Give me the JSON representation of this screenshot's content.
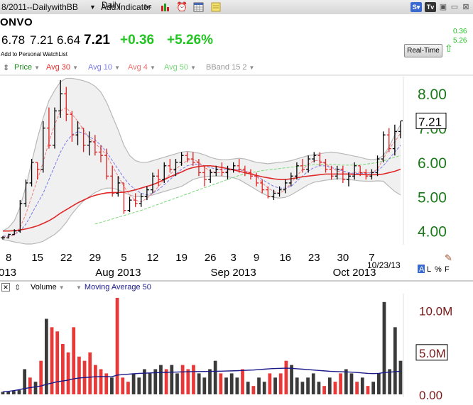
{
  "window": {
    "title": "8/2011--DailywithBB",
    "add_indicator": "Add Indicator",
    "interval": "Daily"
  },
  "toolbar_icons": [
    "wrench-icon",
    "bar-chart-icon",
    "alarm-clock-icon",
    "calendar-icon",
    "note-icon"
  ],
  "titlebar_buttons": [
    "s-button",
    "tv-button",
    "save-icon",
    "window-icon",
    "close-icon"
  ],
  "quote": {
    "symbol": "ONVO",
    "open": "6.78",
    "high": "7.21",
    "low": "6.64",
    "last": "7.21",
    "change": "+0.36",
    "change_pct": "+5.26%",
    "watchlist": "Add to Personal WatchList",
    "realtime_label": "Real-Time",
    "realtime_change": "0.36",
    "realtime_pct": "5.26"
  },
  "price_legend": [
    {
      "label": "Price",
      "color": "#1a8a1a"
    },
    {
      "label": "Avg 30",
      "color": "#e83030"
    },
    {
      "label": "Avg 10",
      "color": "#7a7ae6"
    },
    {
      "label": "Avg 4",
      "color": "#f07070"
    },
    {
      "label": "Avg 50",
      "color": "#77d877"
    },
    {
      "label": "BBand 15 2",
      "color": "#999999"
    }
  ],
  "volume_legend": [
    {
      "label": "Volume",
      "color": "#000000"
    },
    {
      "label": "Moving Average 50",
      "color": "#1a1a8a"
    }
  ],
  "date_label": "10/23/13",
  "scale_buttons": [
    "A",
    "L",
    "%",
    "F"
  ],
  "chart_data": {
    "type": "bar",
    "price_axis": {
      "min": 3.6,
      "max": 8.5,
      "ticks": [
        "8.00",
        "7.00",
        "6.00",
        "5.00",
        "4.00"
      ],
      "tick_values": [
        8,
        7,
        6,
        5,
        4
      ],
      "last_label": "7.21"
    },
    "volume_axis": {
      "min": 0,
      "max": 12,
      "ticks": [
        "10.0M",
        "5.0M",
        "0.00"
      ],
      "tick_values": [
        10,
        5,
        0
      ]
    },
    "x_ticks": [
      {
        "label": "8",
        "i": 1
      },
      {
        "label": "15",
        "i": 6
      },
      {
        "label": "22",
        "i": 11
      },
      {
        "label": "29",
        "i": 16
      },
      {
        "label": "5",
        "i": 21
      },
      {
        "label": "12",
        "i": 26
      },
      {
        "label": "19",
        "i": 31
      },
      {
        "label": "26",
        "i": 36
      },
      {
        "label": "3",
        "i": 40
      },
      {
        "label": "9",
        "i": 44
      },
      {
        "label": "16",
        "i": 49
      },
      {
        "label": "23",
        "i": 54
      },
      {
        "label": "30",
        "i": 59
      },
      {
        "label": "7",
        "i": 64
      }
    ],
    "x_month_labels": [
      {
        "label": "013",
        "i": 0
      },
      {
        "label": "Aug 2013",
        "i": 20
      },
      {
        "label": "Sep 2013",
        "i": 40
      },
      {
        "label": "Oct 2013",
        "i": 61
      }
    ],
    "ohlc": [
      [
        3.8,
        3.85,
        3.75,
        3.8
      ],
      [
        3.8,
        3.92,
        3.78,
        3.9
      ],
      [
        3.9,
        4.05,
        3.88,
        4.0
      ],
      [
        4.0,
        4.9,
        3.95,
        4.8
      ],
      [
        4.8,
        5.5,
        4.7,
        5.4
      ],
      [
        5.4,
        6.1,
        5.3,
        6.0
      ],
      [
        6.0,
        6.0,
        5.5,
        5.8
      ],
      [
        5.8,
        7.2,
        5.7,
        7.0
      ],
      [
        7.0,
        7.6,
        6.4,
        6.5
      ],
      [
        6.5,
        7.6,
        6.4,
        7.5
      ],
      [
        7.5,
        8.4,
        7.3,
        8.0
      ],
      [
        8.0,
        8.2,
        7.2,
        7.4
      ],
      [
        7.4,
        7.5,
        6.6,
        6.8
      ],
      [
        6.8,
        7.2,
        6.5,
        7.0
      ],
      [
        7.0,
        7.0,
        6.3,
        6.5
      ],
      [
        6.5,
        6.9,
        6.2,
        6.6
      ],
      [
        6.6,
        6.8,
        6.2,
        6.3
      ],
      [
        6.3,
        6.5,
        6.0,
        6.2
      ],
      [
        6.2,
        6.4,
        5.5,
        5.6
      ],
      [
        5.6,
        5.9,
        5.0,
        5.1
      ],
      [
        5.1,
        5.6,
        5.0,
        5.4
      ],
      [
        5.4,
        5.4,
        4.5,
        4.6
      ],
      [
        4.6,
        5.0,
        4.55,
        4.9
      ],
      [
        4.9,
        5.1,
        4.7,
        4.8
      ],
      [
        4.8,
        5.1,
        4.7,
        5.0
      ],
      [
        5.0,
        5.3,
        4.9,
        5.2
      ],
      [
        5.2,
        5.7,
        5.1,
        5.6
      ],
      [
        5.6,
        5.8,
        5.3,
        5.5
      ],
      [
        5.5,
        6.0,
        5.4,
        5.9
      ],
      [
        5.9,
        6.1,
        5.7,
        5.8
      ],
      [
        5.8,
        6.1,
        5.6,
        6.0
      ],
      [
        6.0,
        6.3,
        5.9,
        6.2
      ],
      [
        6.2,
        6.3,
        6.0,
        6.1
      ],
      [
        6.1,
        6.3,
        5.9,
        6.0
      ],
      [
        6.0,
        6.1,
        5.6,
        5.7
      ],
      [
        5.7,
        5.9,
        5.3,
        5.5
      ],
      [
        5.5,
        5.8,
        5.4,
        5.7
      ],
      [
        5.7,
        5.9,
        5.6,
        5.8
      ],
      [
        5.8,
        6.0,
        5.6,
        5.7
      ],
      [
        5.7,
        5.9,
        5.5,
        5.8
      ],
      [
        5.8,
        6.0,
        5.7,
        5.9
      ],
      [
        5.9,
        6.1,
        5.7,
        5.8
      ],
      [
        5.8,
        5.9,
        5.6,
        5.7
      ],
      [
        5.7,
        5.8,
        5.5,
        5.6
      ],
      [
        5.6,
        5.7,
        5.3,
        5.4
      ],
      [
        5.4,
        5.5,
        5.1,
        5.2
      ],
      [
        5.2,
        5.3,
        4.95,
        5.0
      ],
      [
        5.0,
        5.2,
        4.9,
        5.1
      ],
      [
        5.1,
        5.3,
        5.0,
        5.2
      ],
      [
        5.2,
        5.5,
        5.1,
        5.4
      ],
      [
        5.4,
        5.7,
        5.3,
        5.6
      ],
      [
        5.6,
        6.0,
        5.5,
        5.9
      ],
      [
        5.9,
        6.1,
        5.7,
        5.8
      ],
      [
        5.8,
        6.2,
        5.7,
        6.1
      ],
      [
        6.1,
        6.3,
        6.0,
        6.2
      ],
      [
        6.2,
        6.3,
        5.9,
        6.0
      ],
      [
        6.0,
        6.1,
        5.7,
        5.8
      ],
      [
        5.8,
        5.9,
        5.5,
        5.6
      ],
      [
        5.6,
        5.9,
        5.5,
        5.8
      ],
      [
        5.8,
        5.9,
        5.4,
        5.5
      ],
      [
        5.5,
        5.7,
        5.3,
        5.6
      ],
      [
        5.6,
        6.0,
        5.5,
        5.9
      ],
      [
        5.9,
        5.9,
        5.6,
        5.7
      ],
      [
        5.7,
        5.8,
        5.5,
        5.6
      ],
      [
        5.6,
        5.8,
        5.5,
        5.7
      ],
      [
        5.7,
        6.2,
        5.6,
        6.1
      ],
      [
        6.1,
        6.9,
        6.0,
        6.8
      ],
      [
        6.8,
        7.0,
        6.3,
        6.4
      ],
      [
        6.4,
        7.1,
        6.2,
        6.9
      ],
      [
        6.9,
        7.2,
        6.7,
        7.21
      ]
    ],
    "bband_upper": [
      4.0,
      4.1,
      4.3,
      4.7,
      5.3,
      6.0,
      6.7,
      7.3,
      7.8,
      8.1,
      8.35,
      8.45,
      8.45,
      8.42,
      8.38,
      8.32,
      8.22,
      8.05,
      7.75,
      7.35,
      6.95,
      6.5,
      6.2,
      6.05,
      6.0,
      6.0,
      6.05,
      6.1,
      6.15,
      6.2,
      6.25,
      6.3,
      6.32,
      6.3,
      6.27,
      6.22,
      6.15,
      6.1,
      6.08,
      6.08,
      6.1,
      6.12,
      6.1,
      6.05,
      6.0,
      5.98,
      5.96,
      5.98,
      6.0,
      6.02,
      6.05,
      6.1,
      6.15,
      6.2,
      6.22,
      6.25,
      6.28,
      6.3,
      6.28,
      6.25,
      6.22,
      6.18,
      6.15,
      6.1,
      6.08,
      6.1,
      6.2,
      6.45,
      6.8,
      7.1
    ],
    "bband_lower": [
      3.75,
      3.72,
      3.68,
      3.65,
      3.62,
      3.62,
      3.65,
      3.7,
      3.8,
      3.9,
      4.05,
      4.25,
      4.5,
      4.7,
      4.88,
      5.0,
      5.12,
      5.2,
      5.25,
      5.25,
      5.2,
      5.12,
      5.05,
      5.0,
      5.0,
      5.02,
      5.05,
      5.1,
      5.15,
      5.2,
      5.25,
      5.3,
      5.4,
      5.5,
      5.55,
      5.58,
      5.6,
      5.6,
      5.6,
      5.58,
      5.55,
      5.5,
      5.4,
      5.3,
      5.2,
      5.1,
      5.02,
      4.98,
      4.96,
      4.98,
      5.05,
      5.15,
      5.25,
      5.35,
      5.42,
      5.45,
      5.48,
      5.5,
      5.52,
      5.52,
      5.5,
      5.48,
      5.46,
      5.45,
      5.45,
      5.46,
      5.45,
      5.3,
      5.15,
      5.05
    ],
    "avg30": [
      4.0,
      4.0,
      4.01,
      4.03,
      4.06,
      4.1,
      4.15,
      4.22,
      4.3,
      4.4,
      4.52,
      4.62,
      4.72,
      4.82,
      4.9,
      4.98,
      5.04,
      5.08,
      5.11,
      5.12,
      5.12,
      5.13,
      5.16,
      5.2,
      5.25,
      5.3,
      5.35,
      5.42,
      5.5,
      5.58,
      5.65,
      5.72,
      5.8,
      5.85,
      5.88,
      5.9,
      5.9,
      5.88,
      5.85,
      5.82,
      5.78,
      5.74,
      5.7,
      5.66,
      5.62,
      5.58,
      5.55,
      5.52,
      5.5,
      5.5,
      5.52,
      5.55,
      5.58,
      5.6,
      5.62,
      5.64,
      5.66,
      5.66,
      5.66,
      5.66,
      5.66,
      5.65,
      5.65,
      5.64,
      5.64,
      5.64,
      5.66,
      5.7,
      5.74,
      5.8
    ],
    "avg50": [
      null,
      null,
      null,
      null,
      null,
      null,
      null,
      null,
      null,
      null,
      null,
      null,
      null,
      null,
      null,
      null,
      4.2,
      4.25,
      4.3,
      4.35,
      4.4,
      4.45,
      4.5,
      4.55,
      4.6,
      4.66,
      4.72,
      4.78,
      4.84,
      4.9,
      4.96,
      5.02,
      5.08,
      5.14,
      5.2,
      5.26,
      5.32,
      5.38,
      5.44,
      5.5,
      5.56,
      5.62,
      5.66,
      5.7,
      5.73,
      5.76,
      5.78,
      5.8,
      5.82,
      5.84,
      5.86,
      5.88,
      5.9,
      5.92,
      5.93,
      5.94,
      5.94,
      5.94,
      5.93,
      5.92,
      5.92,
      5.92,
      5.93,
      5.95,
      5.97,
      6.0,
      6.04,
      6.1,
      6.15,
      6.2
    ],
    "avg10": [
      3.85,
      3.85,
      3.9,
      4.0,
      4.2,
      4.5,
      4.8,
      5.1,
      5.5,
      5.9,
      6.3,
      6.6,
      6.8,
      6.9,
      6.85,
      6.75,
      6.65,
      6.5,
      6.3,
      6.05,
      5.8,
      5.55,
      5.35,
      5.2,
      5.1,
      5.05,
      5.1,
      5.2,
      5.35,
      5.5,
      5.65,
      5.8,
      5.9,
      5.95,
      5.95,
      5.9,
      5.85,
      5.8,
      5.8,
      5.8,
      5.8,
      5.78,
      5.75,
      5.7,
      5.6,
      5.5,
      5.4,
      5.3,
      5.25,
      5.25,
      5.3,
      5.45,
      5.6,
      5.75,
      5.85,
      5.9,
      5.9,
      5.85,
      5.8,
      5.75,
      5.7,
      5.68,
      5.68,
      5.68,
      5.7,
      5.75,
      5.9,
      6.1,
      6.3,
      6.5
    ],
    "avg4": [
      3.82,
      3.84,
      3.88,
      4.1,
      4.5,
      5.0,
      5.5,
      6.0,
      6.6,
      7.1,
      7.5,
      7.6,
      7.4,
      7.2,
      6.95,
      6.7,
      6.55,
      6.4,
      6.2,
      5.9,
      5.6,
      5.3,
      5.05,
      4.9,
      4.85,
      4.95,
      5.1,
      5.3,
      5.5,
      5.65,
      5.8,
      5.95,
      6.05,
      6.1,
      6.0,
      5.85,
      5.75,
      5.7,
      5.7,
      5.75,
      5.8,
      5.8,
      5.75,
      5.7,
      5.6,
      5.4,
      5.25,
      5.15,
      5.1,
      5.2,
      5.4,
      5.6,
      5.8,
      5.95,
      6.05,
      6.05,
      5.95,
      5.85,
      5.75,
      5.7,
      5.65,
      5.7,
      5.72,
      5.7,
      5.7,
      5.8,
      6.1,
      6.4,
      6.6,
      6.85
    ],
    "volume": [
      0.3,
      0.3,
      0.4,
      0.5,
      3.0,
      2.0,
      1.5,
      4.0,
      9.0,
      8.0,
      7.5,
      6.0,
      5.0,
      8.0,
      4.5,
      4.0,
      5.0,
      3.5,
      3.0,
      2.5,
      2.0,
      11.5,
      2.0,
      1.5,
      2.5,
      2.0,
      3.0,
      2.5,
      3.0,
      3.5,
      3.0,
      3.5,
      2.5,
      3.5,
      3.0,
      3.5,
      2.5,
      2.0,
      3.0,
      4.0,
      2.5,
      2.0,
      2.5,
      2.0,
      3.0,
      1.5,
      1.0,
      2.0,
      1.5,
      2.5,
      2.0,
      2.5,
      4.0,
      3.5,
      2.0,
      1.5,
      2.0,
      2.5,
      1.5,
      1.0,
      2.0,
      1.5,
      2.5,
      3.0,
      2.5,
      1.5,
      2.0,
      1.0,
      1.5,
      2.5,
      11.0,
      3.0,
      8.0,
      4.0
    ],
    "volume_colors": [
      "k",
      "k",
      "k",
      "k",
      "k",
      "r",
      "k",
      "r",
      "k",
      "r",
      "r",
      "r",
      "r",
      "r",
      "r",
      "r",
      "r",
      "r",
      "r",
      "r",
      "k",
      "r",
      "r",
      "r",
      "k",
      "k",
      "k",
      "k",
      "k",
      "k",
      "r",
      "k",
      "k",
      "r",
      "r",
      "r",
      "k",
      "k",
      "k",
      "k",
      "r",
      "k",
      "k",
      "k",
      "r",
      "k",
      "r",
      "k",
      "k",
      "r",
      "k",
      "r",
      "r",
      "k",
      "k",
      "k",
      "k",
      "k",
      "k",
      "r",
      "k",
      "r",
      "r",
      "k",
      "k",
      "r",
      "k",
      "r",
      "k",
      "k",
      "k",
      "k",
      "k",
      "k"
    ],
    "volume_ma50": [
      0.3,
      0.35,
      0.45,
      0.55,
      0.7,
      0.8,
      0.9,
      1.0,
      1.2,
      1.35,
      1.5,
      1.6,
      1.7,
      1.85,
      1.95,
      2.0,
      2.05,
      2.1,
      2.12,
      2.12,
      2.1,
      2.3,
      2.35,
      2.4,
      2.45,
      2.5,
      2.52,
      2.55,
      2.58,
      2.6,
      2.62,
      2.65,
      2.66,
      2.68,
      2.7,
      2.72,
      2.72,
      2.73,
      2.74,
      2.75,
      2.76,
      2.78,
      2.8,
      2.82,
      2.85,
      2.88,
      2.9,
      2.95,
      3.0,
      3.05,
      3.08,
      3.1,
      3.12,
      3.1,
      3.05,
      3.0,
      2.95,
      2.9,
      2.85,
      2.8,
      2.75,
      2.72,
      2.7,
      2.68,
      2.65,
      2.6,
      2.55,
      2.5,
      2.48,
      2.5,
      2.6,
      2.65,
      2.7,
      2.75
    ]
  }
}
